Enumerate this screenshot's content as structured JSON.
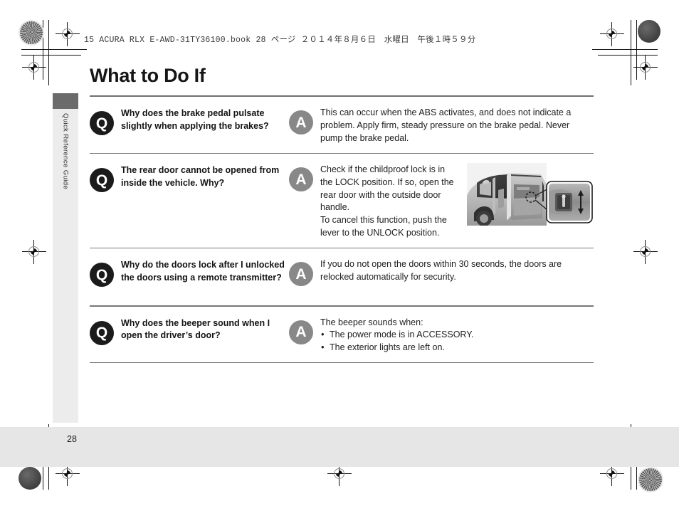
{
  "print_header": "15 ACURA RLX E-AWD-31TY36100.book  28 ページ  ２０１４年８月６日　水曜日　午後１時５９分",
  "sidebar": {
    "tab_label": "Quick Reference Guide"
  },
  "page_title": "What to Do If",
  "page_number": "28",
  "badges": {
    "question": "Q",
    "answer": "A"
  },
  "colors": {
    "question_badge": "#1b1b1b",
    "answer_badge": "#888888",
    "rule": "#6f6f6f",
    "sidebar_bg": "#ececec",
    "sidebar_block": "#6b6b6b",
    "footer_band": "#e6e6e6"
  },
  "qa": [
    {
      "question": "Why does the brake pedal pulsate slightly when applying the brakes?",
      "answer_paragraphs": [
        "This can occur when the ABS activates, and does not indicate a problem. Apply firm, steady pressure on the brake pedal. Never pump the brake pedal."
      ],
      "bullets": [],
      "has_figure": false,
      "figure_caption": ""
    },
    {
      "question": "The rear door cannot be opened from inside the vehicle. Why?",
      "answer_paragraphs": [
        "Check if the childproof lock is in the LOCK position. If so, open the rear door with the outside door handle.",
        "To cancel this function, push the lever to the UNLOCK position."
      ],
      "bullets": [],
      "has_figure": true,
      "figure_caption": "rear door childproof lock lever photo with magnified detail callout"
    },
    {
      "question": "Why do the doors lock after I unlocked the doors using a remote transmitter?",
      "answer_paragraphs": [
        "If you do not open the doors within 30 seconds, the doors are relocked automatically for security."
      ],
      "bullets": [],
      "has_figure": false,
      "figure_caption": ""
    },
    {
      "question": "Why does the beeper sound when I open the driver’s door?",
      "answer_paragraphs": [
        "The beeper sounds when:"
      ],
      "bullets": [
        "The power mode is in ACCESSORY.",
        "The exterior lights are left on."
      ],
      "has_figure": false,
      "figure_caption": ""
    }
  ]
}
